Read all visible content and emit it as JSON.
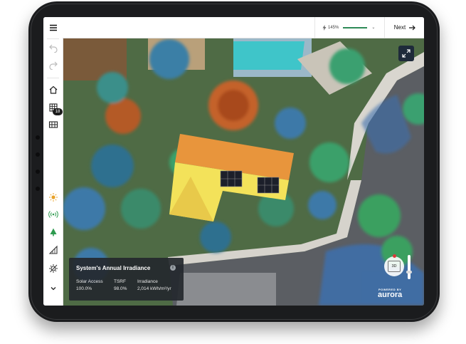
{
  "topbar": {
    "zoom_text": "145%",
    "next_label": "Next"
  },
  "sidebar": {
    "badge_count": "18",
    "items": [
      {
        "icon": "hamburger-icon"
      },
      {
        "icon": "undo-icon"
      },
      {
        "icon": "redo-icon"
      },
      {
        "icon": "home-icon"
      },
      {
        "icon": "solar-panel-grid-icon"
      },
      {
        "icon": "panel-array-icon"
      },
      {
        "icon": "sun-icon"
      },
      {
        "icon": "signal-icon"
      },
      {
        "icon": "tree-icon"
      },
      {
        "icon": "roof-slope-icon"
      },
      {
        "icon": "shade-icon"
      },
      {
        "icon": "chevron-down-icon"
      }
    ]
  },
  "panel": {
    "title": "System's Annual Irradiance",
    "info_glyph": "i",
    "metrics": [
      {
        "label": "Solar Access",
        "value": "100.0%"
      },
      {
        "label": "TSRF",
        "value": "98.0%"
      },
      {
        "label": "Irradiance",
        "value": "2,014 kWh/m²/yr"
      }
    ]
  },
  "view": {
    "mode_label": "3D"
  },
  "branding": {
    "powered_by": "POWERED BY",
    "logo": "aurora"
  },
  "colors": {
    "accent_green": "#2e8b57",
    "panel_bg": "#24282e",
    "roof_orange": "#e8953c",
    "roof_yellow": "#f3e25a"
  }
}
